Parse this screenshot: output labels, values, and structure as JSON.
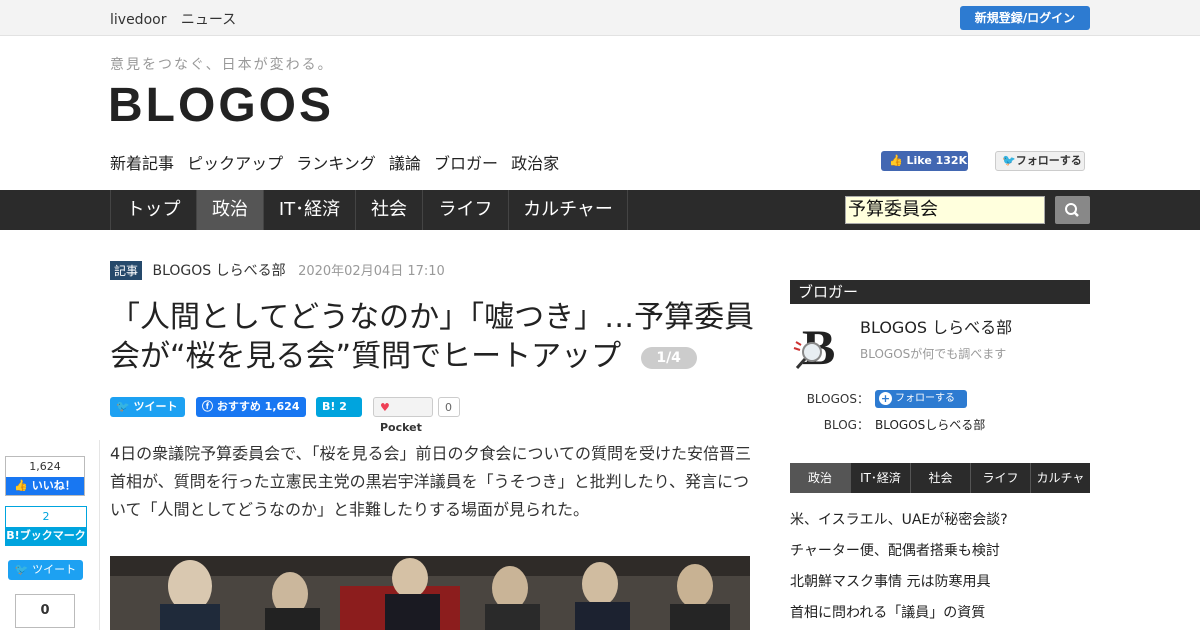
{
  "topbar": {
    "brand": "livedoor",
    "news": "ニュース",
    "login": "新規登録/ログイン"
  },
  "header": {
    "tagline": "意見をつなぐ、日本が変わる。",
    "logo": "BLOGOS"
  },
  "subnav": [
    "新着記事",
    "ピックアップ",
    "ランキング",
    "議論",
    "ブロガー",
    "政治家"
  ],
  "social": {
    "fb_like": "Like 132K",
    "tw_follow": "フォローする"
  },
  "mainnav": [
    {
      "label": "トップ"
    },
    {
      "label": "政治",
      "active": true
    },
    {
      "label": "IT･経済"
    },
    {
      "label": "社会"
    },
    {
      "label": "ライフ"
    },
    {
      "label": "カルチャー"
    }
  ],
  "search": {
    "value": "予算委員会"
  },
  "article": {
    "badge": "記事",
    "author": "BLOGOS しらべる部",
    "date": "2020年02月04日 17:10",
    "title": "「人間としてどうなのか」「嘘つき」…予算委員会が“桜を見る会”質問でヒートアップ",
    "page": "1/4",
    "share": {
      "tweet": "ツイート",
      "fb": "おすすめ 1,624",
      "hatena_count": "2",
      "pocket": "Pocket",
      "pocket_count": "0"
    },
    "body": "4日の衆議院予算委員会で、「桜を見る会」前日の夕食会についての質問を受けた安倍晋三首相が、質問を行った立憲民主党の黒岩宇洋議員を「うそつき」と批判したり、発言について「人間としてどうなのか」と非難したりする場面が見られた。"
  },
  "float_share": {
    "fb_count": "1,624",
    "fb_label": "いいね！",
    "hatena_count": "2",
    "hatena_label": "ブックマーク",
    "tweet": "ツイート",
    "pocket_count": "0"
  },
  "sidebar": {
    "heading": "ブロガー",
    "blogger_name": "BLOGOS しらべる部",
    "blogger_desc": "BLOGOSが何でも調べます",
    "blogos_label": "BLOGOS：",
    "follow": "フォローする",
    "blog_label": "BLOG：",
    "blog_name": "BLOGOSしらべる部",
    "tabs": [
      {
        "label": "政治",
        "active": true
      },
      {
        "label": "IT･経済"
      },
      {
        "label": "社会"
      },
      {
        "label": "ライフ"
      },
      {
        "label": "カルチャー"
      }
    ],
    "news": [
      "米、イスラエル、UAEが秘密会談?",
      "チャーター便、配偶者搭乗も検討",
      "北朝鮮マスク事情 元は防寒用具",
      "首相に問われる「議員」の資質"
    ]
  }
}
